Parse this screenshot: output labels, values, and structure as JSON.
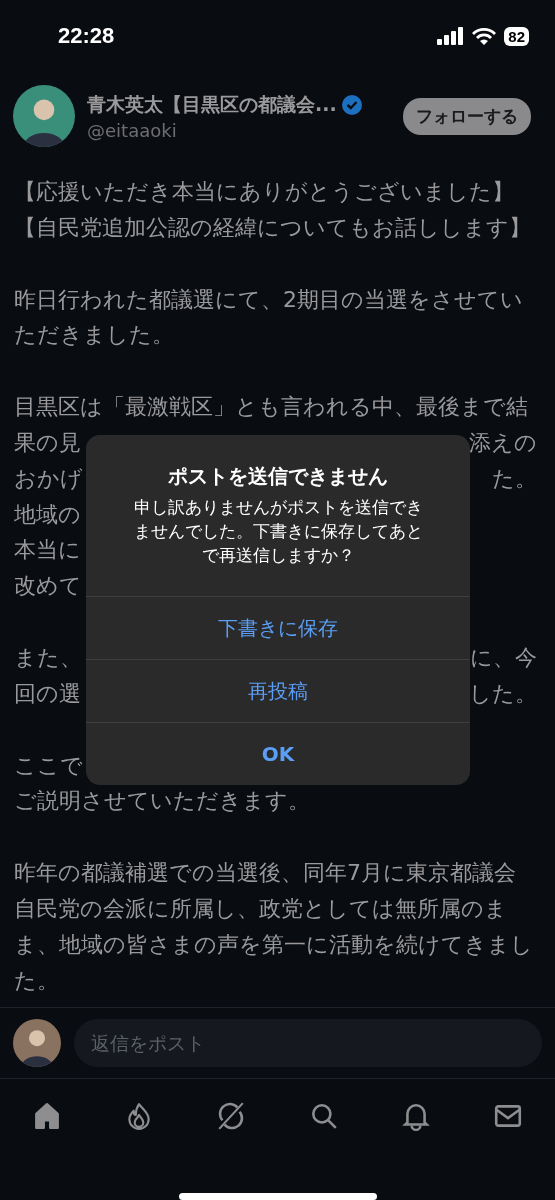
{
  "status_bar": {
    "time": "22:28",
    "battery": "82"
  },
  "author": {
    "name": "青木英太【目黒区の都議会...",
    "verified": true,
    "handle": "@eitaaoki",
    "follow_label": "フォローする"
  },
  "post": {
    "paragraphs": [
      {
        "lines": [
          {
            "left": "【応援いただき本当にありがとうございました】"
          },
          {
            "left": "【自民党追加公認の経緯についてもお話しします】"
          }
        ]
      },
      {
        "lines": [
          {
            "left": "昨日行われた都議選にて、2期目の当選をさせてい"
          },
          {
            "left": "ただきました。"
          }
        ]
      },
      {
        "lines": [
          {
            "left": "目黒区は「最激戦区」とも言われる中、最後まで結"
          },
          {
            "left": "果の見",
            "right": "添えの"
          },
          {
            "left": "おかげ",
            "right": "た。"
          },
          {
            "left": "地域の"
          },
          {
            "left": "本当に"
          },
          {
            "left": "改めて"
          }
        ]
      },
      {
        "lines": [
          {
            "left": "また、",
            "right": "に、今"
          },
          {
            "left": "回の選",
            "right": "した。"
          }
        ]
      },
      {
        "lines": [
          {
            "left": "ここで"
          },
          {
            "left": "ご説明させていただきます。"
          }
        ]
      },
      {
        "lines": [
          {
            "left": "昨年の都議補選での当選後、同年7月に東京都議会"
          },
          {
            "left": "自民党の会派に所属し、政党としては無所属のま"
          },
          {
            "left": "ま、地域の皆さまの声を第一に活動を続けてきまし"
          },
          {
            "left": "た。"
          }
        ]
      }
    ]
  },
  "dialog": {
    "title": "ポストを送信できません",
    "message": "申し訳ありませんがポストを送信できませんでした。下書きに保存してあとで再送信しますか？",
    "buttons": [
      {
        "label": "下書きに保存",
        "kind": "normal"
      },
      {
        "label": "再投稿",
        "kind": "normal"
      },
      {
        "label": "OK",
        "kind": "bold"
      }
    ]
  },
  "reply": {
    "placeholder": "返信をポスト"
  },
  "tab_bar": [
    {
      "kind": "home",
      "selected": true
    },
    {
      "kind": "fire",
      "selected": false
    },
    {
      "kind": "slash",
      "selected": false
    },
    {
      "kind": "search",
      "selected": false
    },
    {
      "kind": "bell",
      "selected": false
    },
    {
      "kind": "mail",
      "selected": false
    }
  ]
}
